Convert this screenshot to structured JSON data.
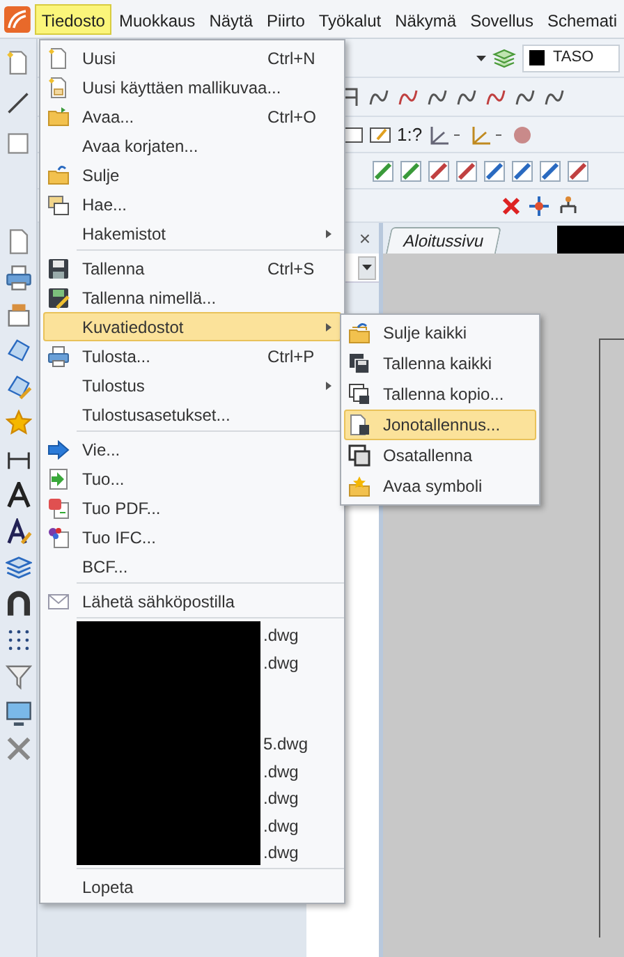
{
  "menubar": [
    {
      "label": "Tiedosto",
      "selected": true
    },
    {
      "label": "Muokkaus",
      "selected": false
    },
    {
      "label": "Näytä",
      "selected": false
    },
    {
      "label": "Piirto",
      "selected": false
    },
    {
      "label": "Työkalut",
      "selected": false
    },
    {
      "label": "Näkymä",
      "selected": false
    },
    {
      "label": "Sovellus",
      "selected": false
    },
    {
      "label": "Schemati",
      "selected": false
    }
  ],
  "toolbar": {
    "layer_label": "TASO",
    "scale_label": "1:?"
  },
  "side_panel": {
    "close": "×"
  },
  "tabs": [
    {
      "label": "Aloitussivu"
    }
  ],
  "file_menu": {
    "items": [
      {
        "kind": "item",
        "label": "Uusi",
        "shortcut": "Ctrl+N",
        "submenu": false,
        "selected": false
      },
      {
        "kind": "item",
        "label": "Uusi käyttäen mallikuvaa...",
        "submenu": false,
        "selected": false
      },
      {
        "kind": "item",
        "label": "Avaa...",
        "shortcut": "Ctrl+O",
        "submenu": false,
        "selected": false
      },
      {
        "kind": "item",
        "label": "Avaa korjaten...",
        "submenu": false,
        "selected": false
      },
      {
        "kind": "item",
        "label": "Sulje",
        "submenu": false,
        "selected": false
      },
      {
        "kind": "item",
        "label": "Hae...",
        "submenu": false,
        "selected": false
      },
      {
        "kind": "item",
        "label": "Hakemistot",
        "submenu": true,
        "selected": false
      },
      {
        "kind": "separator"
      },
      {
        "kind": "item",
        "label": "Tallenna",
        "shortcut": "Ctrl+S",
        "submenu": false,
        "selected": false
      },
      {
        "kind": "item",
        "label": "Tallenna nimellä...",
        "submenu": false,
        "selected": false
      },
      {
        "kind": "item",
        "label": "Kuvatiedostot",
        "submenu": true,
        "selected": true
      },
      {
        "kind": "item",
        "label": "Tulosta...",
        "shortcut": "Ctrl+P",
        "submenu": false,
        "selected": false
      },
      {
        "kind": "item",
        "label": "Tulostus",
        "submenu": true,
        "selected": false
      },
      {
        "kind": "item",
        "label": "Tulostusasetukset...",
        "submenu": false,
        "selected": false
      },
      {
        "kind": "separator"
      },
      {
        "kind": "item",
        "label": "Vie...",
        "submenu": false,
        "selected": false
      },
      {
        "kind": "item",
        "label": "Tuo...",
        "submenu": false,
        "selected": false
      },
      {
        "kind": "item",
        "label": "Tuo PDF...",
        "submenu": false,
        "selected": false
      },
      {
        "kind": "item",
        "label": "Tuo IFC...",
        "submenu": false,
        "selected": false
      },
      {
        "kind": "item",
        "label": "BCF...",
        "submenu": false,
        "selected": false
      },
      {
        "kind": "separator"
      },
      {
        "kind": "item",
        "label": "Lähetä sähköpostilla",
        "submenu": false,
        "selected": false
      },
      {
        "kind": "separator"
      },
      {
        "kind": "recent"
      },
      {
        "kind": "separator"
      },
      {
        "kind": "item",
        "label": "Lopeta",
        "submenu": false,
        "selected": false
      }
    ],
    "recent_files": [
      {
        "text": ".dwg"
      },
      {
        "text": ".dwg"
      },
      {
        "text": "5.dwg"
      },
      {
        "text": ".dwg"
      },
      {
        "text": ".dwg"
      },
      {
        "text": ".dwg"
      },
      {
        "text": ".dwg"
      }
    ]
  },
  "submenu": {
    "items": [
      {
        "label": "Sulje kaikki",
        "selected": false
      },
      {
        "label": "Tallenna kaikki",
        "selected": false
      },
      {
        "label": "Tallenna kopio...",
        "selected": false
      },
      {
        "label": "Jonotallennus...",
        "selected": true
      },
      {
        "label": "Osatallenna",
        "selected": false
      },
      {
        "label": "Avaa symboli",
        "selected": false
      }
    ]
  }
}
